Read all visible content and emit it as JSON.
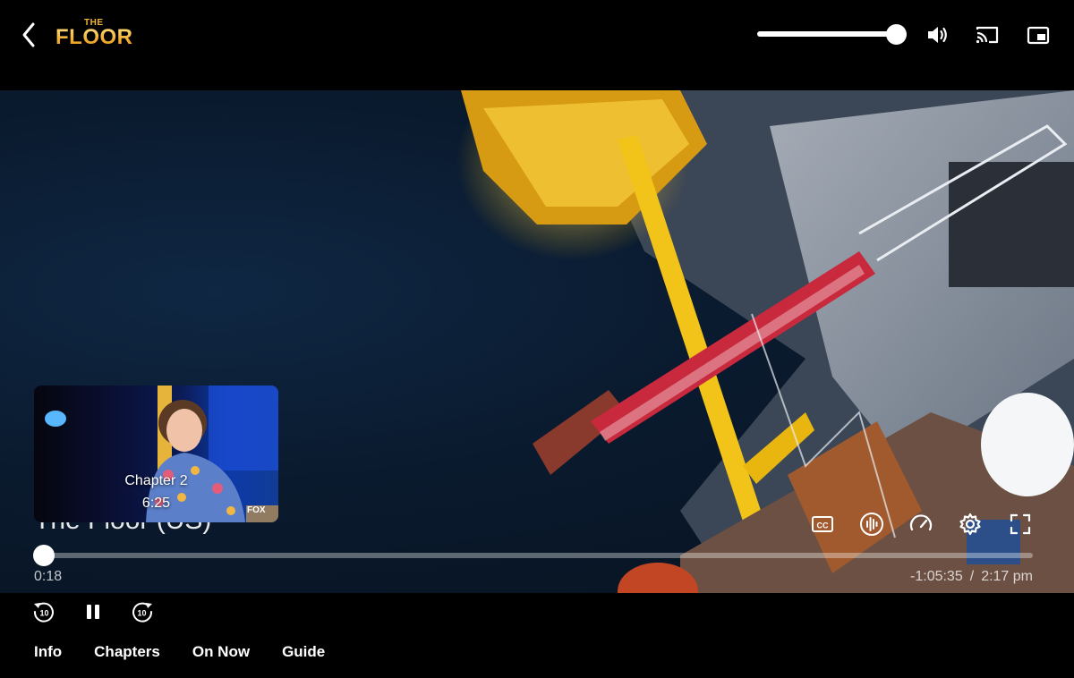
{
  "header": {
    "logo_small": "THE",
    "logo_main": "FLOOR",
    "icons": [
      "back-arrow-icon",
      "volume-icon",
      "cast-icon",
      "picture-in-picture-icon"
    ],
    "volume_level": 1.0
  },
  "player": {
    "show_title": "The Floor (US)",
    "elapsed": "0:18",
    "remaining": "-1:05:35",
    "separator": "/",
    "end_time": "2:17 pm",
    "progress": 0.0,
    "controls": [
      "closed-captions-icon",
      "audio-icon",
      "playback-speed-icon",
      "settings-icon",
      "fullscreen-icon"
    ]
  },
  "preview": {
    "chapter": "Chapter 2",
    "time": "6:25",
    "network_logo": "FOX"
  },
  "playback": {
    "icons": [
      "rewind-10-icon",
      "pause-icon",
      "forward-10-icon"
    ],
    "skip_label": "10"
  },
  "tabs": [
    {
      "label": "Info"
    },
    {
      "label": "Chapters"
    },
    {
      "label": "On Now"
    },
    {
      "label": "Guide"
    }
  ],
  "colors": {
    "accent": "#f2b632",
    "background": "#000000",
    "track": "#ffffff"
  }
}
